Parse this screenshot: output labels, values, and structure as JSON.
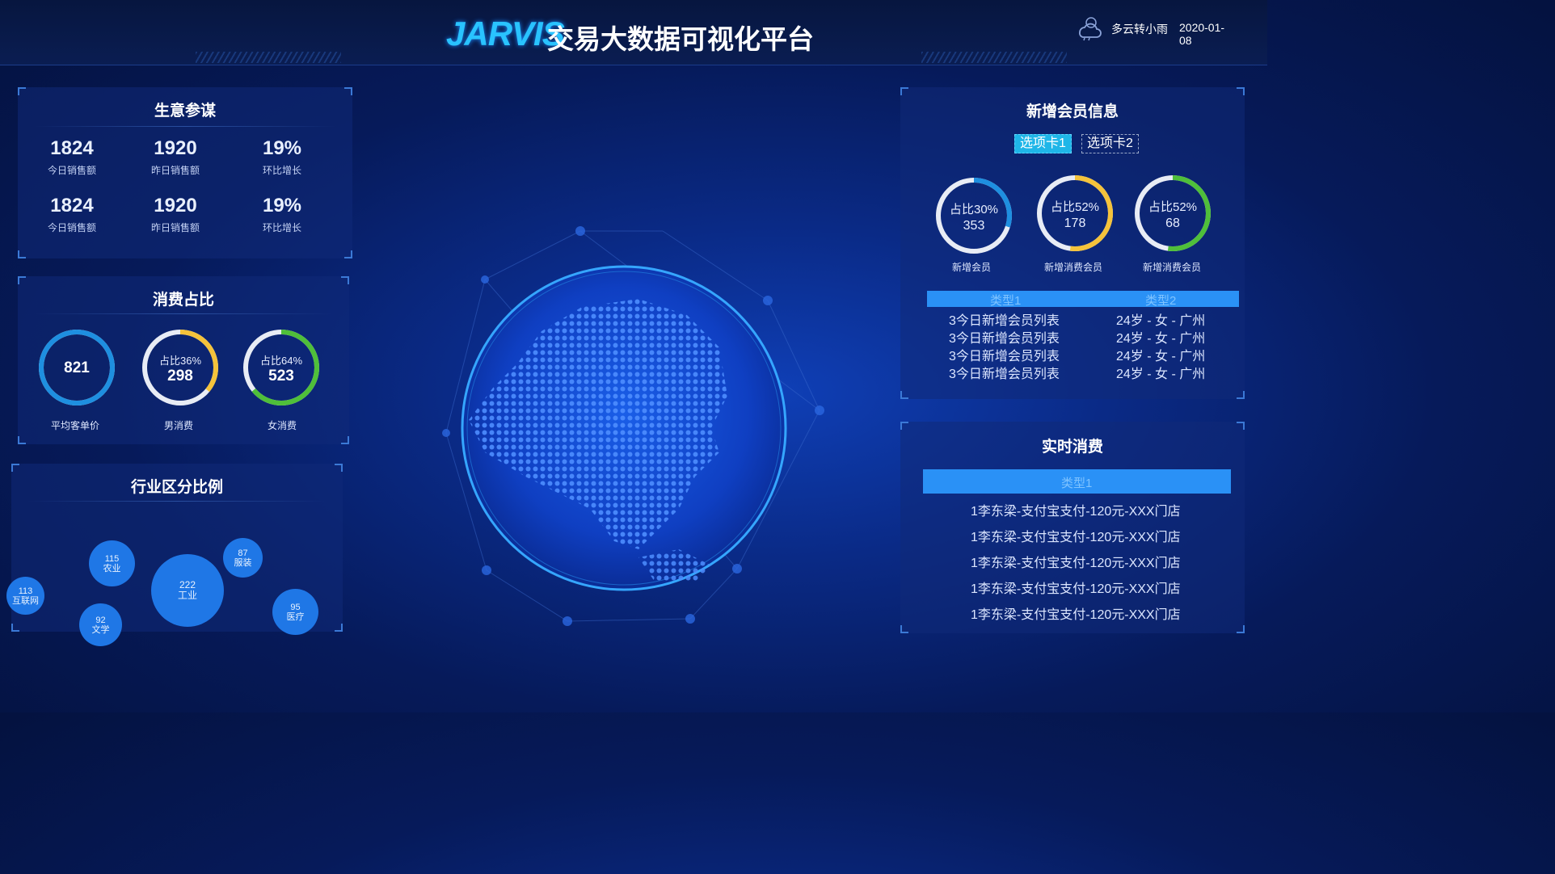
{
  "header": {
    "logo": "JARVIS",
    "title": "交易大数据可视化平台",
    "weather_icon": "cloud-rain-icon",
    "weather": "多云转小雨",
    "date": "2020-01-08"
  },
  "business": {
    "title": "生意参谋",
    "stats": [
      {
        "value": "1824",
        "label": "今日销售额"
      },
      {
        "value": "1920",
        "label": "昨日销售额"
      },
      {
        "value": "19%",
        "label": "环比增长"
      },
      {
        "value": "1824",
        "label": "今日销售额"
      },
      {
        "value": "1920",
        "label": "昨日销售额"
      },
      {
        "value": "19%",
        "label": "环比增长"
      }
    ]
  },
  "consumption": {
    "title": "消费占比",
    "rings": [
      {
        "top": "",
        "value": "821",
        "label": "平均客单价",
        "percent": 100,
        "color": "#1e8fe0"
      },
      {
        "top": "占比36%",
        "value": "298",
        "label": "男消费",
        "percent": 36,
        "color": "#f5c33b"
      },
      {
        "top": "占比64%",
        "value": "523",
        "label": "女消费",
        "percent": 64,
        "color": "#4fbf3a"
      }
    ]
  },
  "industry": {
    "title": "行业区分比例",
    "bubbles": [
      {
        "value": "113",
        "name": "互联网"
      },
      {
        "value": "115",
        "name": "农业"
      },
      {
        "value": "92",
        "name": "文学"
      },
      {
        "value": "222",
        "name": "工业"
      },
      {
        "value": "87",
        "name": "服装"
      },
      {
        "value": "95",
        "name": "医疗"
      }
    ]
  },
  "members": {
    "title": "新增会员信息",
    "tabs": [
      "选项卡1",
      "选项卡2"
    ],
    "rings": [
      {
        "top": "占比30%",
        "value": "353",
        "label": "新增会员",
        "percent": 30,
        "color": "#1e8fe0"
      },
      {
        "top": "占比52%",
        "value": "178",
        "label": "新增消费会员",
        "percent": 52,
        "color": "#f5c33b"
      },
      {
        "top": "占比52%",
        "value": "68",
        "label": "新增消费会员",
        "percent": 52,
        "color": "#4fbf3a"
      }
    ],
    "columns": [
      "类型1",
      "类型2"
    ],
    "rows": [
      [
        "3今日新增会员列表",
        "24岁 - 女 - 广州"
      ],
      [
        "3今日新增会员列表",
        "24岁 - 女 - 广州"
      ],
      [
        "3今日新增会员列表",
        "24岁 - 女 - 广州"
      ],
      [
        "3今日新增会员列表",
        "24岁 - 女 - 广州"
      ]
    ]
  },
  "realtime": {
    "title": "实时消费",
    "column": "类型1",
    "rows": [
      "1李东梁-支付宝支付-120元-XXX门店",
      "1李东梁-支付宝支付-120元-XXX门店",
      "1李东梁-支付宝支付-120元-XXX门店",
      "1李东梁-支付宝支付-120元-XXX门店",
      "1李东梁-支付宝支付-120元-XXX门店"
    ]
  }
}
